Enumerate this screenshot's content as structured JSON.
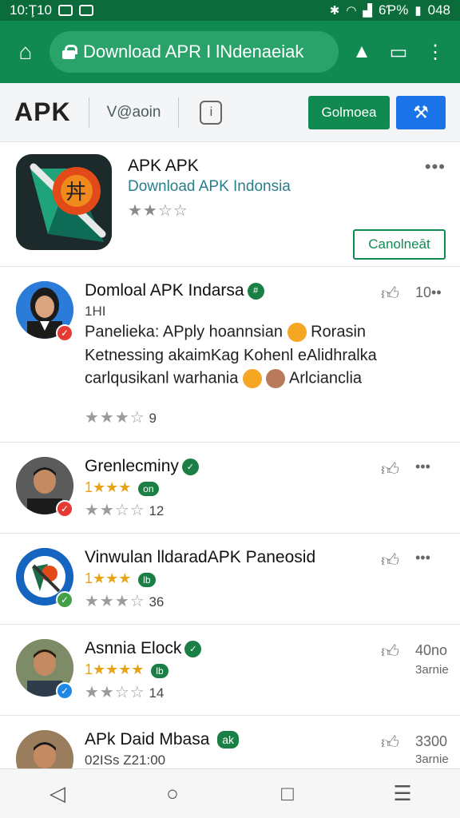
{
  "status_bar": {
    "time": "10:Ţ10",
    "battery": "6Ƥ%",
    "clock_right": "048"
  },
  "browser": {
    "url_text": "Download APR I lNdenaeiak"
  },
  "toolbar": {
    "brand": "APK",
    "search_text": "V@aoin",
    "green_button": "Golmoea",
    "blue_button": "⚒"
  },
  "app": {
    "title": "APK APK",
    "subtitle": "Download APK Indonsia",
    "stars": "★★☆☆",
    "rating_value": 2,
    "more": "•••",
    "action_button": "Canolneāt"
  },
  "reviews": [
    {
      "name": "Domloal APK Indarsa",
      "time": "1HI",
      "right": "10••",
      "line1": "Panelieka: APply hoannsian",
      "line1b": "Rorasin",
      "line2": "Ketnessing akaimKag Kohenl eAlidhralka",
      "line3": "carlqusikanl warhania",
      "line3b": "Arlcianclia",
      "stars": "★★★☆",
      "count": "9",
      "badge_color": "#e53935"
    },
    {
      "name": "Grenlecminy",
      "gold": "1★★★",
      "chip": "on",
      "stars": "★★☆☆",
      "count": "12",
      "right": "•••",
      "badge_color": "#e53935"
    },
    {
      "name": "Vinwulan lldaradAPK Paneosid",
      "gold": "1★★★",
      "chip": "lb",
      "stars": "★★★☆",
      "count": "36",
      "right": "•••",
      "badge_color": "#43a047"
    },
    {
      "name": "Asnnia Elock",
      "gold": "1★★★★",
      "chip": "lb",
      "stars": "★★☆☆",
      "count": "14",
      "right": "40no",
      "right2": "3arnie",
      "badge_color": "#1e88e5"
    },
    {
      "name": "APk Daid Mbasa",
      "name_tag": "ak",
      "sub": "02ISs Z21:00",
      "right": "3300",
      "right2": "3arnie"
    }
  ],
  "nav": {
    "back": "◁",
    "home": "○",
    "recent": "□",
    "menu": "☰"
  }
}
